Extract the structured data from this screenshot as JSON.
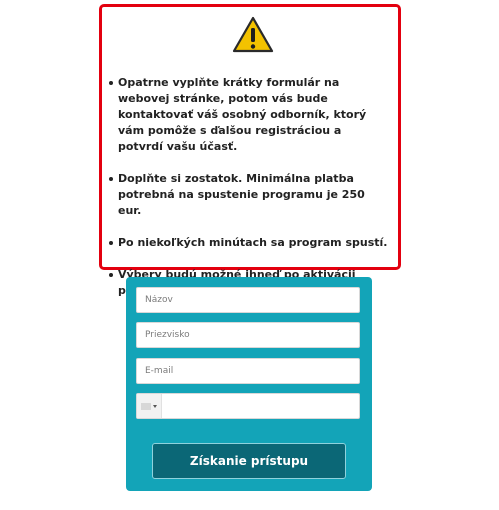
{
  "notice": {
    "icon": "warning-icon",
    "border_color": "#e3000f",
    "items": [
      "Opatrne vyplňte krátky formulár na webovej stránke, potom vás bude kontaktovať váš osobný odborník, ktorý vám pomôže s ďalšou registráciou a potvrdí vašu účasť.",
      "Doplňte si zostatok. Minimálna platba potrebná na spustenie programu je 250 eur.",
      "Po niekoľkých minútach sa program spustí.",
      "Výbery budú možné ihneď po aktivácii programu"
    ]
  },
  "form": {
    "background": "#13a4b8",
    "first_name_placeholder": "Názov",
    "last_name_placeholder": "Priezvisko",
    "email_placeholder": "E-mail",
    "phone_placeholder": "",
    "country_flag_icon": "flag-icon",
    "submit_label": "Získanie prístupu",
    "submit_color": "#0b6776"
  }
}
